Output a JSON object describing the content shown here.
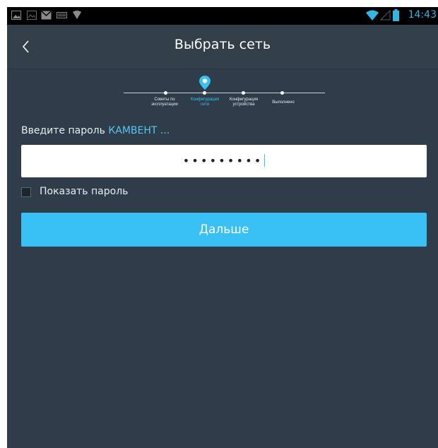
{
  "status_bar": {
    "time": "14:43",
    "left_icons": [
      "image-icon",
      "photo-icon",
      "mail-icon",
      "keyboard-icon",
      "signal-icon"
    ],
    "right_icons": [
      "wifi-icon",
      "cellular-icon",
      "battery-icon"
    ],
    "accent_color": "#33b5e5"
  },
  "header": {
    "title": "Выбрать сеть",
    "back_icon": "chevron-left-icon"
  },
  "stepper": {
    "steps": [
      {
        "label": "Советы по\nэксплуатации",
        "active": false
      },
      {
        "label": "Конфигурация\nсети",
        "active": true
      },
      {
        "label": "Конфигурация\nустройства",
        "active": false
      },
      {
        "label": "Выполнено",
        "active": false
      }
    ],
    "current_marker_icon": "location-pin-icon"
  },
  "form": {
    "prompt_prefix": "Введите пароль",
    "network_name": "КАМВЕНТ ...",
    "password_masked": "•••••••••",
    "show_password_label": "Показать пароль",
    "show_password_checked": false,
    "next_button_label": "Дальше"
  },
  "colors": {
    "background": "#2e3d49",
    "header": "#323e48",
    "accent": "#39c0f5"
  }
}
